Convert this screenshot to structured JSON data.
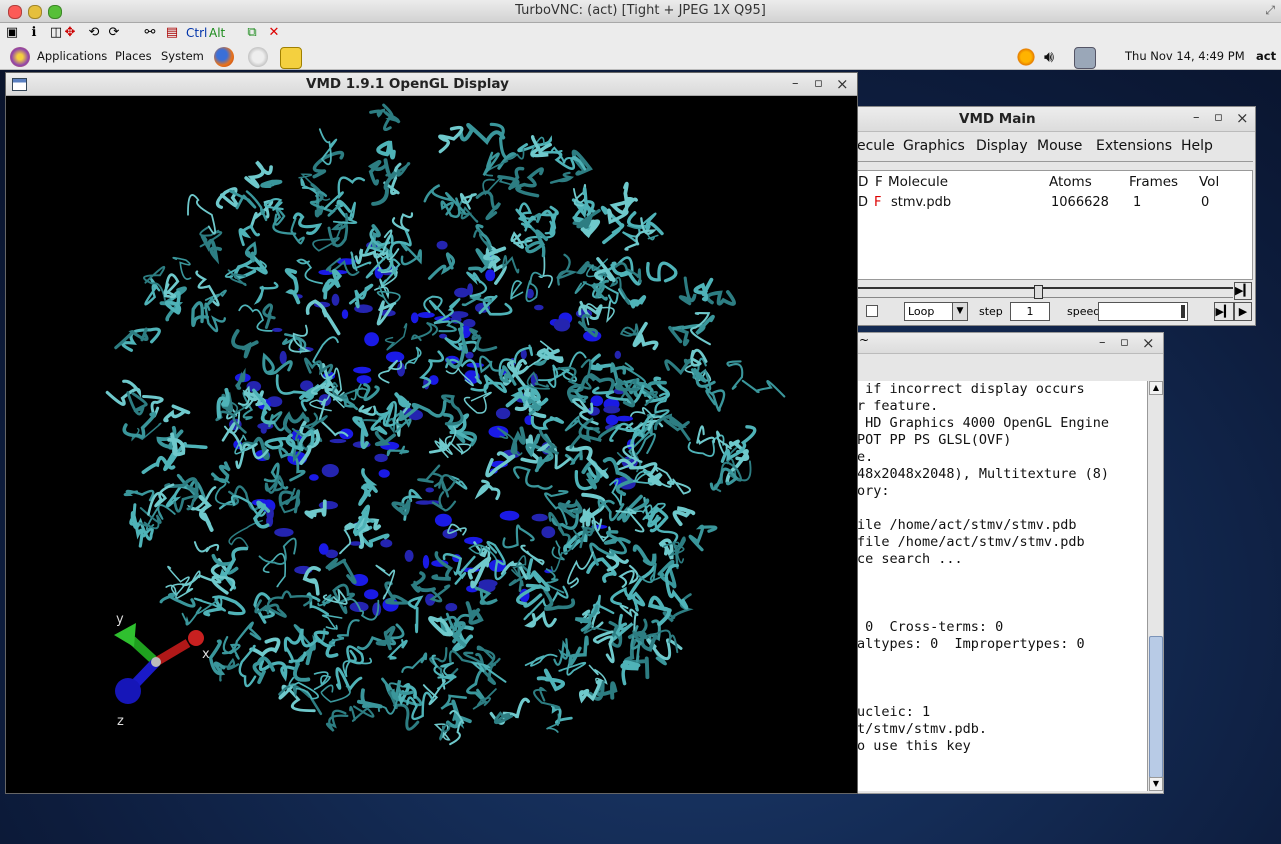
{
  "mac_titlebar": {
    "title": "TurboVNC: (act) [Tight + JPEG 1X Q95]"
  },
  "vnc_toolbar": {
    "ctrl_label": "Ctrl",
    "alt_label": "Alt"
  },
  "panel": {
    "applications": "Applications",
    "places": "Places",
    "system": "System",
    "datetime": "Thu Nov 14,  4:49 PM",
    "user": "act"
  },
  "vmd_display": {
    "title": "VMD 1.9.1 OpenGL Display",
    "axes": {
      "x": "x",
      "y": "y",
      "z": "z"
    }
  },
  "vmd_main": {
    "title": "VMD Main",
    "menu": [
      "ecule",
      "Graphics",
      "Display",
      "Mouse",
      "Extensions",
      "Help"
    ],
    "columns": {
      "d": "D",
      "f": "F",
      "molecule": "Molecule",
      "atoms": "Atoms",
      "frames": "Frames",
      "vol": "Vol"
    },
    "row": {
      "d": "D",
      "f": "F",
      "molecule": "stmv.pdb",
      "atoms": "1066628",
      "frames": "1",
      "vol": "0"
    },
    "controls": {
      "loop": "Loop",
      "step_label": "step",
      "step_value": "1",
      "speed_label": "speed"
    }
  },
  "console": {
    "title": "~",
    "lines": [
      " if incorrect display occurs",
      "r feature.",
      " HD Graphics 4000 OpenGL Engine",
      "POT PP PS GLSL(OVF)",
      "e.",
      "48x2048x2048), Multitexture (8)",
      "ory:",
      "",
      "ile /home/act/stmv/stmv.pdb",
      "file /home/act/stmv/stmv.pdb",
      "ce search ...",
      "",
      "",
      "",
      " 0  Cross-terms: 0",
      "altypes: 0  Impropertypes: 0",
      "",
      "",
      "",
      "ucleic: 1",
      "t/stmv/stmv.pdb.",
      "o use this key"
    ]
  }
}
